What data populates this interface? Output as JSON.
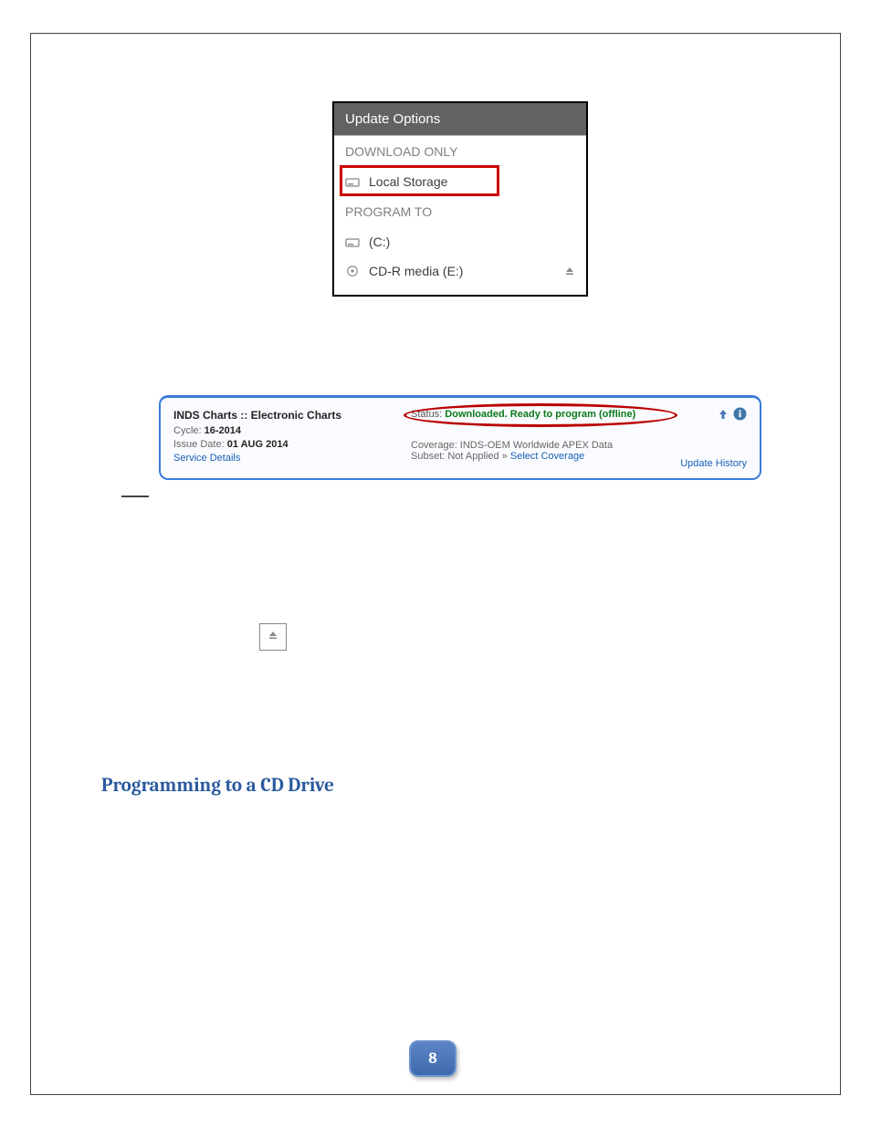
{
  "updatePanel": {
    "title": "Update Options",
    "downloadOnlyLabel": "DOWNLOAD ONLY",
    "localStorageLabel": "Local Storage",
    "programToLabel": "PROGRAM TO",
    "driveC": "(C:)",
    "cdr": "CD-R media (E:)"
  },
  "statusBanner": {
    "title": "INDS Charts :: Electronic Charts",
    "cycleLabel": "Cycle: ",
    "cycleValue": "16-2014",
    "issueLabel": "Issue Date: ",
    "issueValue": "01 AUG 2014",
    "serviceDetails": "Service Details",
    "statusPrefix": "Status: ",
    "statusValue": "Downloaded. Ready to program (offline)",
    "coverage": "Coverage: INDS-OEM Worldwide APEX Data",
    "subsetPrefix": "Subset: Not Applied » ",
    "selectCoverage": "Select Coverage",
    "updateHistory": "Update History"
  },
  "heading": "Programming to a CD Drive",
  "pageNumber": "8"
}
